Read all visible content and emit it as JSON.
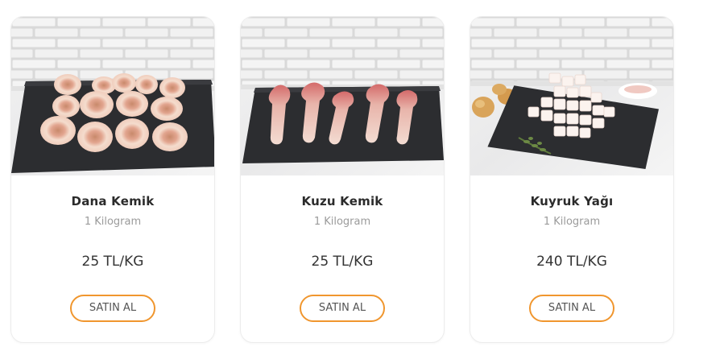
{
  "colors": {
    "accent": "#f0962e",
    "title": "#2b2b2b",
    "subtitle": "#9b9b9b",
    "price": "#333333",
    "card_border": "#ececec"
  },
  "products": [
    {
      "name": "Dana Kemik",
      "unit": "1 Kilogram",
      "price": "25 TL/KG",
      "buy_label": "SATIN AL",
      "image": "beef-bone-slices-on-slate-photo"
    },
    {
      "name": "Kuzu Kemik",
      "unit": "1 Kilogram",
      "price": "25 TL/KG",
      "buy_label": "SATIN AL",
      "image": "lamb-bones-on-slate-photo"
    },
    {
      "name": "Kuyruk Yağı",
      "unit": "1 Kilogram",
      "price": "240 TL/KG",
      "buy_label": "SATIN AL",
      "image": "tail-fat-cubes-on-slate-photo"
    }
  ]
}
